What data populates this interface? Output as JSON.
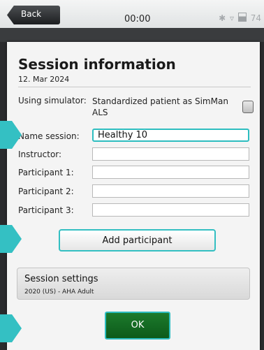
{
  "statusbar": {
    "back_label": "Back",
    "time": "00:00",
    "battery_text": "74"
  },
  "session": {
    "title": "Session information",
    "date": "12. Mar 2024",
    "simulator_label": "Using simulator:",
    "simulator_value": "Standardized patient as SimMan ALS",
    "name_label": "Name session:",
    "name_value": "Healthy 10",
    "instructor_label": "Instructor:",
    "participant1_label": "Participant 1:",
    "participant2_label": "Participant 2:",
    "participant3_label": "Participant 3:"
  },
  "buttons": {
    "add_participant": "Add participant",
    "ok": "OK"
  },
  "settings": {
    "title": "Session settings",
    "subtitle": "2020 (US) - AHA Adult"
  },
  "colors": {
    "accent": "#2dbdc0",
    "ok_green": "#1c7a2c"
  }
}
